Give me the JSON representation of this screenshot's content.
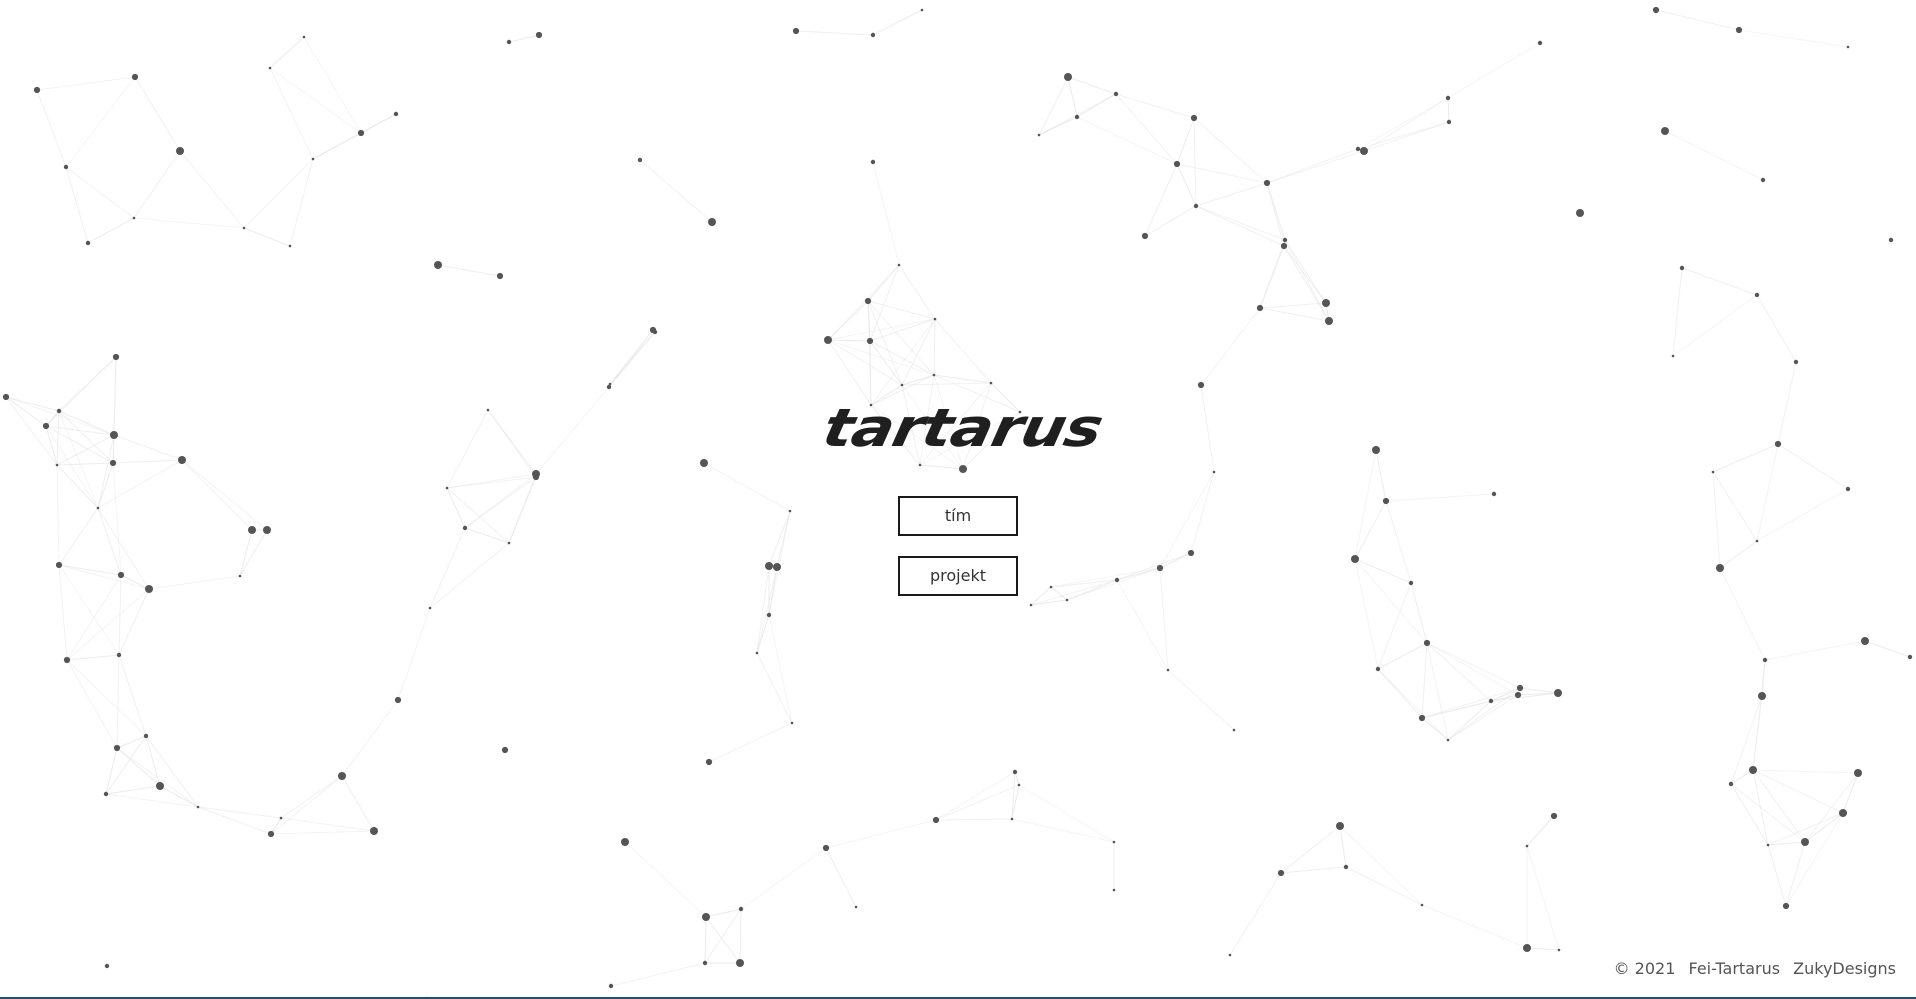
{
  "brand": {
    "logo_text": "tartarus"
  },
  "nav": {
    "team_label": "tím",
    "project_label": "projekt"
  },
  "footer": {
    "copyright": "© 2021",
    "org": "Fei-Tartarus",
    "designer": "ZukyDesigns"
  },
  "colors": {
    "background": "#ffffff",
    "particle": "#555555",
    "link_line": "#e6e6e6",
    "button_border": "#1a1a1a",
    "bottom_strip": "#2c4a6b"
  },
  "icons": {
    "background": "particle-network"
  }
}
